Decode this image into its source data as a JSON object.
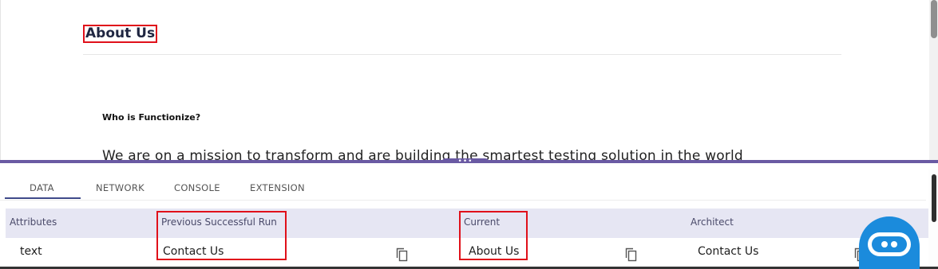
{
  "preview": {
    "heading": "About Us",
    "section_title": "Who is Functionize?",
    "cut_text": "We are on a mission to transform and are building the smartest testing solution in the world"
  },
  "splitter": {
    "handle_label": "•••"
  },
  "tabs": [
    {
      "label": "DATA",
      "active": true
    },
    {
      "label": "NETWORK",
      "active": false
    },
    {
      "label": "CONSOLE",
      "active": false
    },
    {
      "label": "EXTENSION",
      "active": false
    }
  ],
  "table": {
    "columns": [
      "Attributes",
      "Previous Successful Run",
      "Current",
      "Architect"
    ],
    "rows": [
      {
        "attribute": "text",
        "previous": "Contact Us",
        "current": "About Us",
        "architect": "Contact Us"
      }
    ]
  },
  "icons": {
    "copy": "copy-icon",
    "bot": "chatbot-icon"
  },
  "colors": {
    "accent": "#6a5aa3",
    "highlight": "#e0101a",
    "header_bg": "#e6e6f3",
    "bot": "#1b8bdc"
  }
}
